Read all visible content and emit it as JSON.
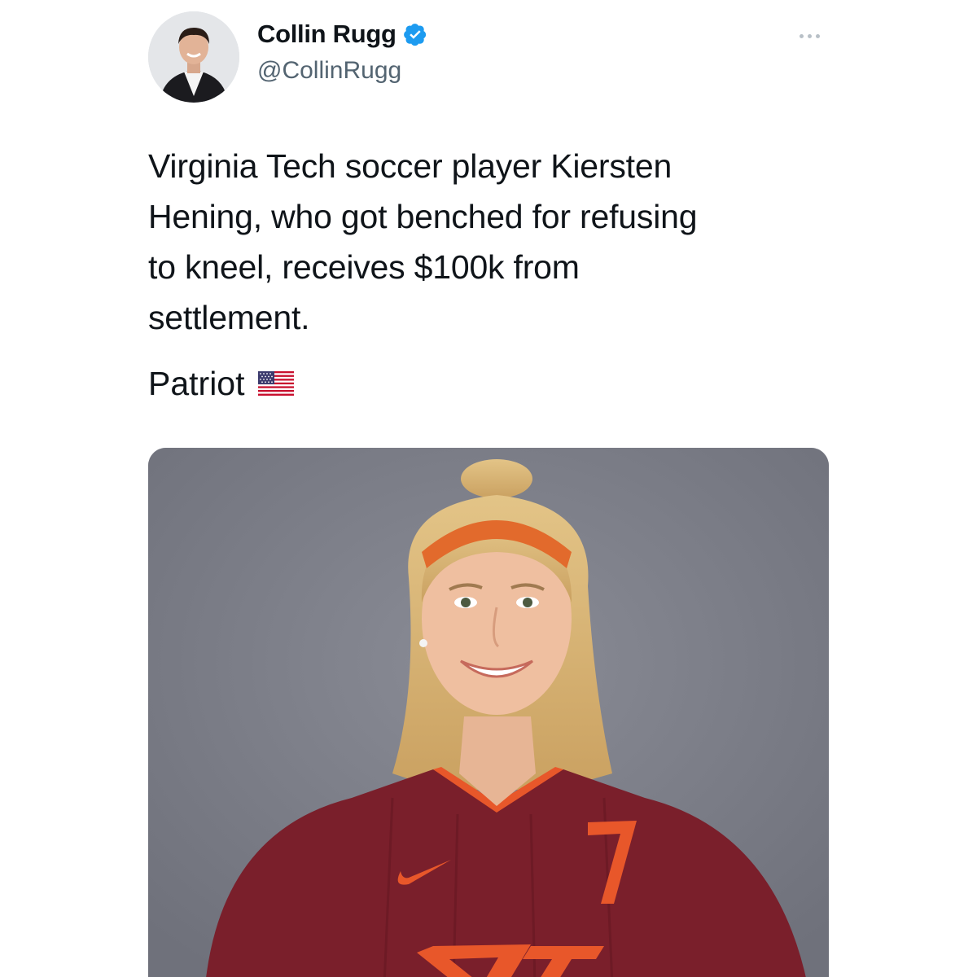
{
  "author": {
    "name": "Collin Rugg",
    "handle": "@CollinRugg",
    "verified": true,
    "avatar": "profile-photo"
  },
  "menu_icon": "more-horizontal-icon",
  "tweet": {
    "lines": [
      "Virginia Tech soccer player Kiersten",
      "Hening, who got benched for refusing",
      "to kneel, receives $100k from",
      "settlement."
    ],
    "tag_text": "Patriot",
    "tag_emoji": "us-flag-icon"
  },
  "media": {
    "kind": "photo",
    "jersey_number": "7",
    "jersey_logo": "VT",
    "colors": {
      "background": "#7d7f89",
      "jersey": "#7a1f2b",
      "accent": "#e8572a"
    }
  },
  "colors": {
    "text": "#0f1419",
    "secondary_text": "#536471",
    "verified_badge": "#1d9bf0",
    "background": "#ffffff"
  }
}
